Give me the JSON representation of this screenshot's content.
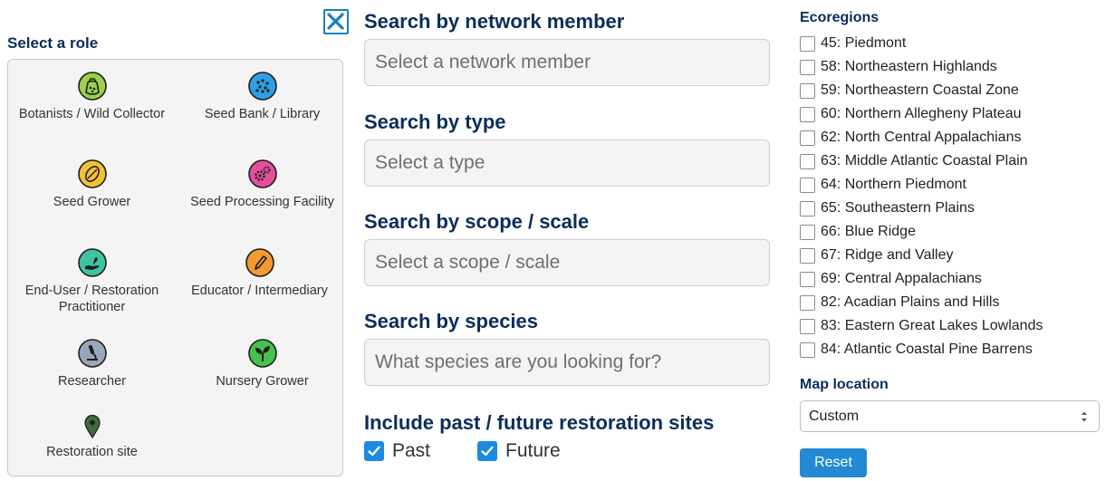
{
  "role_panel": {
    "title": "Select a role",
    "roles": [
      {
        "label": "Botanists / Wild Collector",
        "icon": "seed-bag-icon",
        "color": "#9bd04a"
      },
      {
        "label": "Seed Bank / Library",
        "icon": "seed-bank-icon",
        "color": "#2e9fe6"
      },
      {
        "label": "Seed Grower",
        "icon": "seed-icon",
        "color": "#f1c233"
      },
      {
        "label": "Seed Processing Facility",
        "icon": "gears-icon",
        "color": "#e24f9a"
      },
      {
        "label": "End-User / Restoration Practitioner",
        "icon": "hand-sprout-icon",
        "color": "#3fc3a0"
      },
      {
        "label": "Educator / Intermediary",
        "icon": "pencil-icon",
        "color": "#f39a32"
      },
      {
        "label": "Researcher",
        "icon": "microscope-icon",
        "color": "#9aa7bb"
      },
      {
        "label": "Nursery Grower",
        "icon": "seedling-icon",
        "color": "#46c24a"
      },
      {
        "label": "Restoration site",
        "icon": "map-pin-icon",
        "color": "#3f6b3a"
      }
    ]
  },
  "search": {
    "member": {
      "title": "Search by network member",
      "placeholder": "Select a network member"
    },
    "type": {
      "title": "Search by type",
      "placeholder": "Select a type"
    },
    "scope": {
      "title": "Search by scope / scale",
      "placeholder": "Select a scope / scale"
    },
    "species": {
      "title": "Search by species",
      "placeholder": "What species are you looking for?"
    },
    "sites": {
      "title": "Include past / future restoration sites",
      "past_label": "Past",
      "future_label": "Future",
      "past_checked": true,
      "future_checked": true
    }
  },
  "ecoregions": {
    "title": "Ecoregions",
    "items": [
      "45: Piedmont",
      "58: Northeastern Highlands",
      "59: Northeastern Coastal Zone",
      "60: Northern Allegheny Plateau",
      "62: North Central Appalachians",
      "63: Middle Atlantic Coastal Plain",
      "64: Northern Piedmont",
      "65: Southeastern Plains",
      "66: Blue Ridge",
      "67: Ridge and Valley",
      "69: Central Appalachians",
      "82: Acadian Plains and Hills",
      "83: Eastern Great Lakes Lowlands",
      "84: Atlantic Coastal Pine Barrens"
    ]
  },
  "map_location": {
    "title": "Map location",
    "selected": "Custom"
  },
  "reset_label": "Reset",
  "colors": {
    "heading": "#0b2d5b",
    "accent": "#1b8be0",
    "reset": "#2389d5"
  }
}
